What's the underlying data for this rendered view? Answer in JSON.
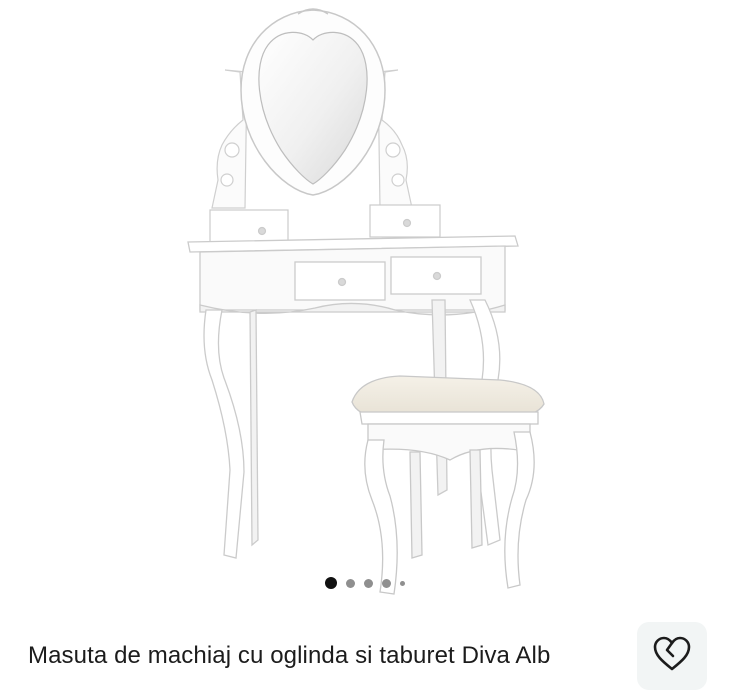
{
  "product": {
    "title": "Masuta de machiaj cu oglinda si taburet Diva Alb",
    "image_icon": "dressing-table-photo"
  },
  "carousel": {
    "total_dots": 5,
    "active_index": 0
  },
  "favorite": {
    "icon": "heart-icon"
  },
  "colors": {
    "background": "#ffffff",
    "fav_button_bg": "#f2f5f5",
    "dot_active": "#111111",
    "dot_inactive": "#8f8f8f",
    "text": "#1c1c1c"
  }
}
